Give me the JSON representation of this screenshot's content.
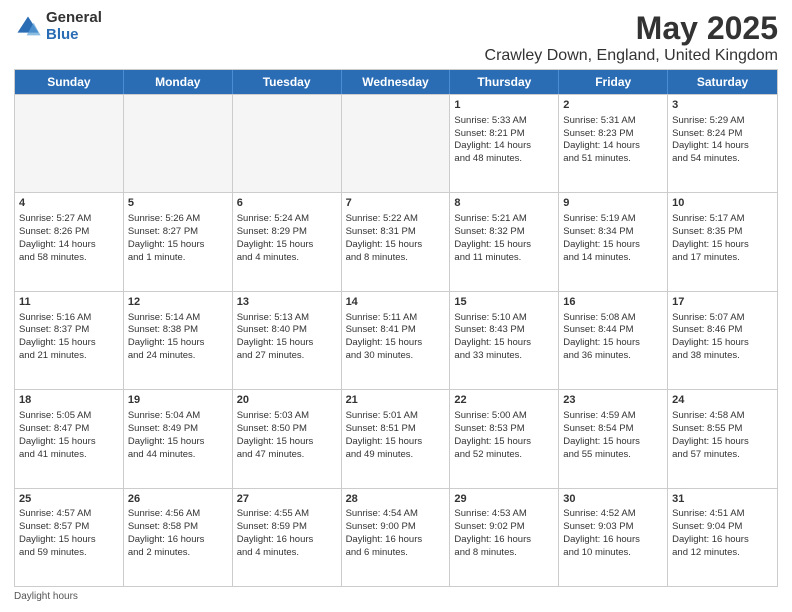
{
  "logo": {
    "general": "General",
    "blue": "Blue"
  },
  "title": "May 2025",
  "subtitle": "Crawley Down, England, United Kingdom",
  "header_days": [
    "Sunday",
    "Monday",
    "Tuesday",
    "Wednesday",
    "Thursday",
    "Friday",
    "Saturday"
  ],
  "footer": "Daylight hours",
  "weeks": [
    [
      {
        "day": "",
        "content": "",
        "empty": true
      },
      {
        "day": "",
        "content": "",
        "empty": true
      },
      {
        "day": "",
        "content": "",
        "empty": true
      },
      {
        "day": "",
        "content": "",
        "empty": true
      },
      {
        "day": "1",
        "content": "Sunrise: 5:33 AM\nSunset: 8:21 PM\nDaylight: 14 hours\nand 48 minutes.",
        "empty": false
      },
      {
        "day": "2",
        "content": "Sunrise: 5:31 AM\nSunset: 8:23 PM\nDaylight: 14 hours\nand 51 minutes.",
        "empty": false
      },
      {
        "day": "3",
        "content": "Sunrise: 5:29 AM\nSunset: 8:24 PM\nDaylight: 14 hours\nand 54 minutes.",
        "empty": false
      }
    ],
    [
      {
        "day": "4",
        "content": "Sunrise: 5:27 AM\nSunset: 8:26 PM\nDaylight: 14 hours\nand 58 minutes.",
        "empty": false
      },
      {
        "day": "5",
        "content": "Sunrise: 5:26 AM\nSunset: 8:27 PM\nDaylight: 15 hours\nand 1 minute.",
        "empty": false
      },
      {
        "day": "6",
        "content": "Sunrise: 5:24 AM\nSunset: 8:29 PM\nDaylight: 15 hours\nand 4 minutes.",
        "empty": false
      },
      {
        "day": "7",
        "content": "Sunrise: 5:22 AM\nSunset: 8:31 PM\nDaylight: 15 hours\nand 8 minutes.",
        "empty": false
      },
      {
        "day": "8",
        "content": "Sunrise: 5:21 AM\nSunset: 8:32 PM\nDaylight: 15 hours\nand 11 minutes.",
        "empty": false
      },
      {
        "day": "9",
        "content": "Sunrise: 5:19 AM\nSunset: 8:34 PM\nDaylight: 15 hours\nand 14 minutes.",
        "empty": false
      },
      {
        "day": "10",
        "content": "Sunrise: 5:17 AM\nSunset: 8:35 PM\nDaylight: 15 hours\nand 17 minutes.",
        "empty": false
      }
    ],
    [
      {
        "day": "11",
        "content": "Sunrise: 5:16 AM\nSunset: 8:37 PM\nDaylight: 15 hours\nand 21 minutes.",
        "empty": false
      },
      {
        "day": "12",
        "content": "Sunrise: 5:14 AM\nSunset: 8:38 PM\nDaylight: 15 hours\nand 24 minutes.",
        "empty": false
      },
      {
        "day": "13",
        "content": "Sunrise: 5:13 AM\nSunset: 8:40 PM\nDaylight: 15 hours\nand 27 minutes.",
        "empty": false
      },
      {
        "day": "14",
        "content": "Sunrise: 5:11 AM\nSunset: 8:41 PM\nDaylight: 15 hours\nand 30 minutes.",
        "empty": false
      },
      {
        "day": "15",
        "content": "Sunrise: 5:10 AM\nSunset: 8:43 PM\nDaylight: 15 hours\nand 33 minutes.",
        "empty": false
      },
      {
        "day": "16",
        "content": "Sunrise: 5:08 AM\nSunset: 8:44 PM\nDaylight: 15 hours\nand 36 minutes.",
        "empty": false
      },
      {
        "day": "17",
        "content": "Sunrise: 5:07 AM\nSunset: 8:46 PM\nDaylight: 15 hours\nand 38 minutes.",
        "empty": false
      }
    ],
    [
      {
        "day": "18",
        "content": "Sunrise: 5:05 AM\nSunset: 8:47 PM\nDaylight: 15 hours\nand 41 minutes.",
        "empty": false
      },
      {
        "day": "19",
        "content": "Sunrise: 5:04 AM\nSunset: 8:49 PM\nDaylight: 15 hours\nand 44 minutes.",
        "empty": false
      },
      {
        "day": "20",
        "content": "Sunrise: 5:03 AM\nSunset: 8:50 PM\nDaylight: 15 hours\nand 47 minutes.",
        "empty": false
      },
      {
        "day": "21",
        "content": "Sunrise: 5:01 AM\nSunset: 8:51 PM\nDaylight: 15 hours\nand 49 minutes.",
        "empty": false
      },
      {
        "day": "22",
        "content": "Sunrise: 5:00 AM\nSunset: 8:53 PM\nDaylight: 15 hours\nand 52 minutes.",
        "empty": false
      },
      {
        "day": "23",
        "content": "Sunrise: 4:59 AM\nSunset: 8:54 PM\nDaylight: 15 hours\nand 55 minutes.",
        "empty": false
      },
      {
        "day": "24",
        "content": "Sunrise: 4:58 AM\nSunset: 8:55 PM\nDaylight: 15 hours\nand 57 minutes.",
        "empty": false
      }
    ],
    [
      {
        "day": "25",
        "content": "Sunrise: 4:57 AM\nSunset: 8:57 PM\nDaylight: 15 hours\nand 59 minutes.",
        "empty": false
      },
      {
        "day": "26",
        "content": "Sunrise: 4:56 AM\nSunset: 8:58 PM\nDaylight: 16 hours\nand 2 minutes.",
        "empty": false
      },
      {
        "day": "27",
        "content": "Sunrise: 4:55 AM\nSunset: 8:59 PM\nDaylight: 16 hours\nand 4 minutes.",
        "empty": false
      },
      {
        "day": "28",
        "content": "Sunrise: 4:54 AM\nSunset: 9:00 PM\nDaylight: 16 hours\nand 6 minutes.",
        "empty": false
      },
      {
        "day": "29",
        "content": "Sunrise: 4:53 AM\nSunset: 9:02 PM\nDaylight: 16 hours\nand 8 minutes.",
        "empty": false
      },
      {
        "day": "30",
        "content": "Sunrise: 4:52 AM\nSunset: 9:03 PM\nDaylight: 16 hours\nand 10 minutes.",
        "empty": false
      },
      {
        "day": "31",
        "content": "Sunrise: 4:51 AM\nSunset: 9:04 PM\nDaylight: 16 hours\nand 12 minutes.",
        "empty": false
      }
    ]
  ]
}
